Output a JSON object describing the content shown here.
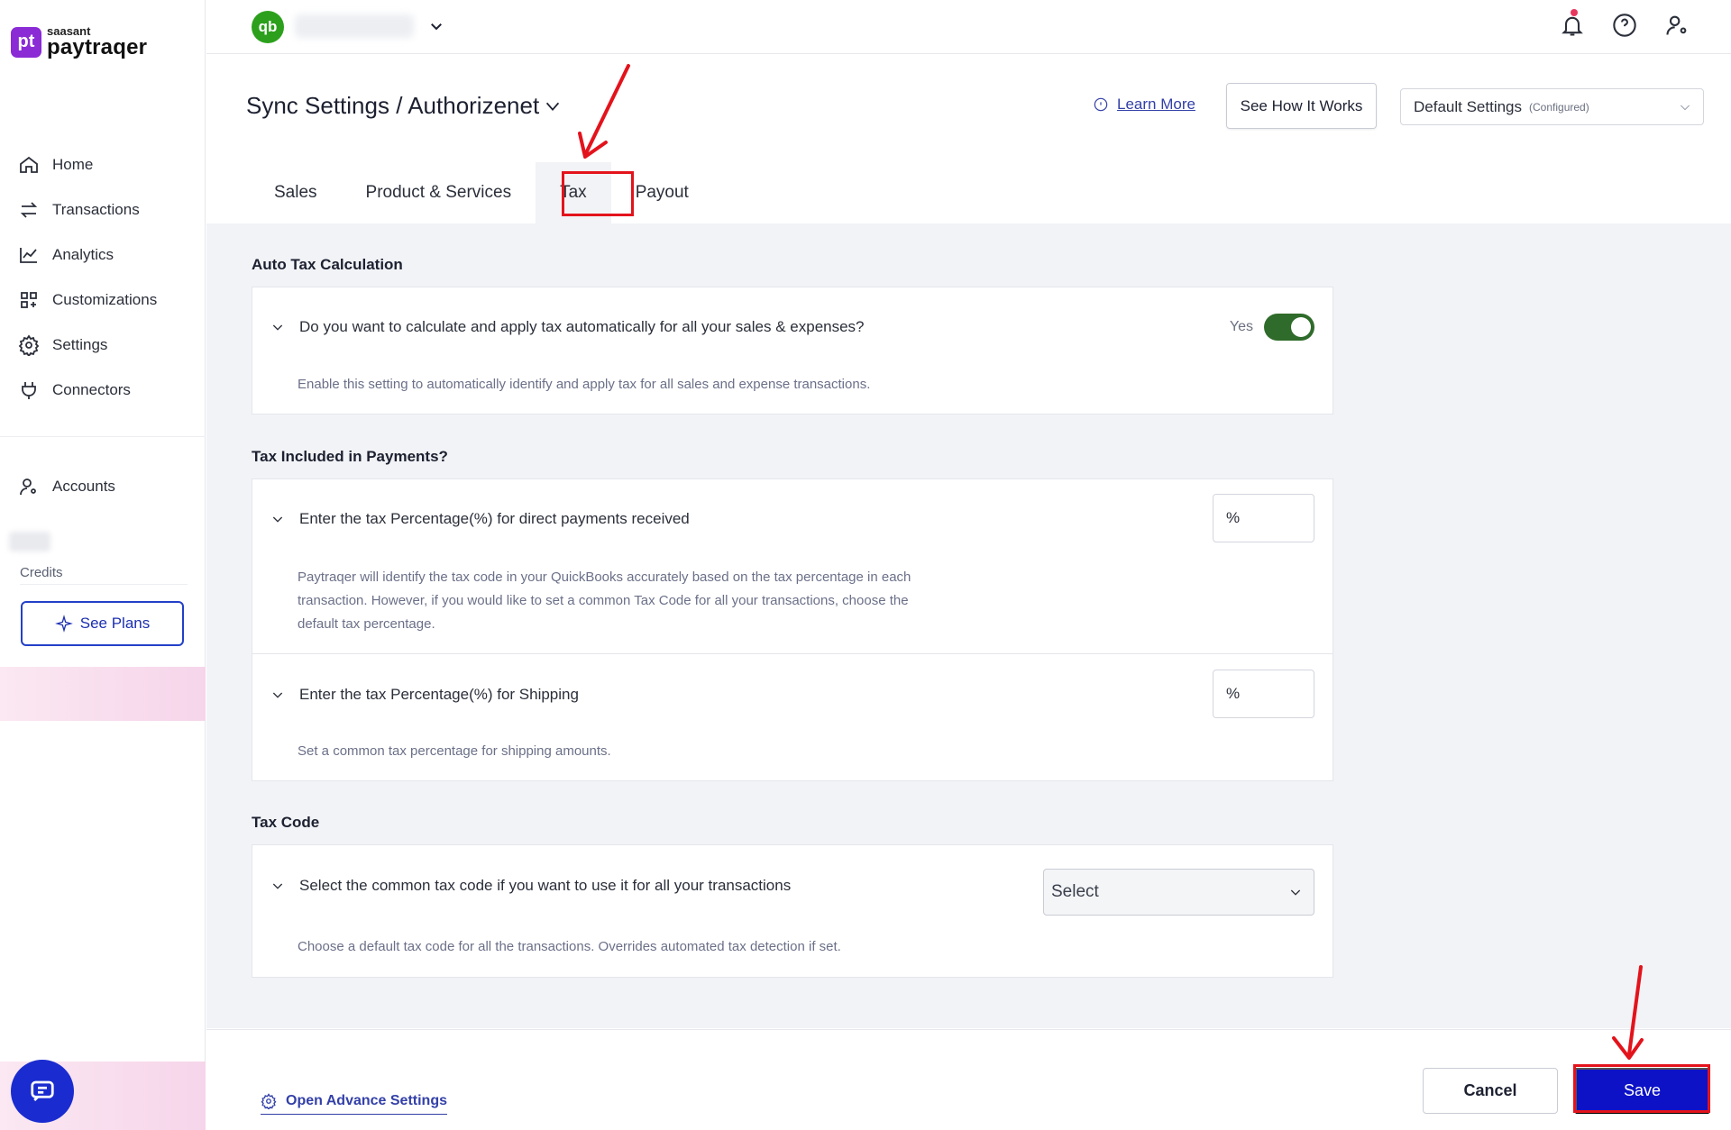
{
  "sidebar": {
    "logo_small": "saasant",
    "logo_big": "paytraqer",
    "logo_mark": "pt",
    "items": [
      {
        "label": "Home",
        "icon": "home-icon"
      },
      {
        "label": "Transactions",
        "icon": "transactions-icon"
      },
      {
        "label": "Analytics",
        "icon": "analytics-icon"
      },
      {
        "label": "Customizations",
        "icon": "customizations-icon"
      },
      {
        "label": "Settings",
        "icon": "settings-icon"
      },
      {
        "label": "Connectors",
        "icon": "connectors-icon"
      }
    ],
    "accounts_label": "Accounts",
    "credits_label": "Credits",
    "see_plans_label": "See Plans"
  },
  "topbar": {
    "qb_logo": "qb"
  },
  "header": {
    "title": "Sync Settings / Authorizenet",
    "learn_more": "Learn More",
    "see_how": "See How It Works",
    "default_settings": "Default Settings",
    "default_settings_note": "(Configured)"
  },
  "tabs": [
    {
      "label": "Sales"
    },
    {
      "label": "Product & Services"
    },
    {
      "label": "Tax",
      "active": true
    },
    {
      "label": "Payout"
    }
  ],
  "sections": {
    "auto_tax": {
      "title": "Auto Tax Calculation",
      "question": "Do you want to calculate and apply tax automatically for all your sales & expenses?",
      "toggle_label": "Yes",
      "toggle_on": true,
      "description": "Enable this setting to automatically identify and apply tax for all sales and expense transactions."
    },
    "tax_included": {
      "title": "Tax Included in Payments?",
      "direct_question": "Enter the tax Percentage(%) for direct payments received",
      "direct_placeholder": "%",
      "direct_desc_1": "Paytraqer will identify the tax code in your QuickBooks accurately based on the tax percentage in each",
      "direct_desc_2": "transaction. However, if you would like to set a common Tax Code for all your transactions, choose the",
      "direct_desc_3": "default tax percentage.",
      "shipping_question": "Enter the tax Percentage(%) for Shipping",
      "shipping_placeholder": "%",
      "shipping_desc": "Set a common tax percentage for shipping amounts."
    },
    "tax_code": {
      "title": "Tax Code",
      "question": "Select the common tax code if you want to use it for all your transactions",
      "select_value": "Select",
      "description": "Choose a default tax code for all the transactions. Overrides automated tax detection if set."
    }
  },
  "footer": {
    "advance_settings": "Open Advance Settings",
    "cancel": "Cancel",
    "save": "Save"
  },
  "colors": {
    "primary": "#0d12c7",
    "toggle_on": "#2f6b2a",
    "highlight": "#e3131c",
    "logo": "#8a2bd6",
    "quickbooks": "#2ca01c"
  }
}
